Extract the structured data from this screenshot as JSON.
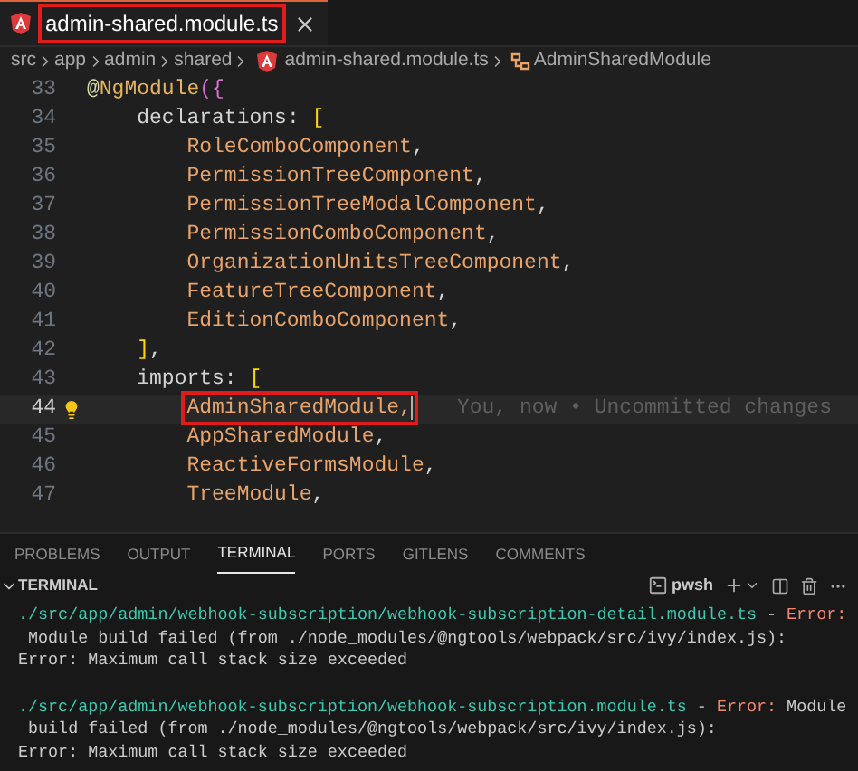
{
  "tabs": [
    {
      "label": "admin-shared.module.ts",
      "selected": true,
      "highlighted": true
    }
  ],
  "breadcrumb": {
    "folders": [
      "src",
      "app",
      "admin",
      "shared"
    ],
    "file": "admin-shared.module.ts",
    "symbol": "AdminSharedModule"
  },
  "code_lines": [
    {
      "number": "33",
      "current": false,
      "segments": [
        {
          "text": "@",
          "kind": "decorator"
        },
        {
          "text": "NgModule",
          "kind": "function"
        },
        {
          "text": "({",
          "kind": "bracket"
        }
      ]
    },
    {
      "number": "34",
      "current": false,
      "segments": [
        {
          "text": "    declarations",
          "kind": "property"
        },
        {
          "text": ": ",
          "kind": "punct"
        },
        {
          "text": "[",
          "kind": "bracket2"
        }
      ]
    },
    {
      "number": "35",
      "current": false,
      "segments": [
        {
          "text": "        RoleComboComponent",
          "kind": "class"
        },
        {
          "text": ",",
          "kind": "punct"
        }
      ]
    },
    {
      "number": "36",
      "current": false,
      "segments": [
        {
          "text": "        PermissionTreeComponent",
          "kind": "class"
        },
        {
          "text": ",",
          "kind": "punct"
        }
      ]
    },
    {
      "number": "37",
      "current": false,
      "segments": [
        {
          "text": "        PermissionTreeModalComponent",
          "kind": "class"
        },
        {
          "text": ",",
          "kind": "punct"
        }
      ]
    },
    {
      "number": "38",
      "current": false,
      "segments": [
        {
          "text": "        PermissionComboComponent",
          "kind": "class"
        },
        {
          "text": ",",
          "kind": "punct"
        }
      ]
    },
    {
      "number": "39",
      "current": false,
      "segments": [
        {
          "text": "        OrganizationUnitsTreeComponent",
          "kind": "class"
        },
        {
          "text": ",",
          "kind": "punct"
        }
      ]
    },
    {
      "number": "40",
      "current": false,
      "segments": [
        {
          "text": "        FeatureTreeComponent",
          "kind": "class"
        },
        {
          "text": ",",
          "kind": "punct"
        }
      ]
    },
    {
      "number": "41",
      "current": false,
      "segments": [
        {
          "text": "        EditionComboComponent",
          "kind": "class"
        },
        {
          "text": ",",
          "kind": "punct"
        }
      ]
    },
    {
      "number": "42",
      "current": false,
      "segments": [
        {
          "text": "    ]",
          "kind": "bracket2"
        },
        {
          "text": ",",
          "kind": "punct"
        }
      ]
    },
    {
      "number": "43",
      "current": false,
      "segments": [
        {
          "text": "    imports",
          "kind": "property"
        },
        {
          "text": ": ",
          "kind": "punct"
        },
        {
          "text": "[",
          "kind": "bracket2"
        }
      ]
    },
    {
      "number": "44",
      "current": true,
      "blame": "You, now • Uncommitted changes",
      "segments": [
        {
          "text": "        AdminSharedModule,",
          "kind": "class",
          "highlighted": true
        }
      ]
    },
    {
      "number": "45",
      "current": false,
      "segments": [
        {
          "text": "        AppSharedModule",
          "kind": "class"
        },
        {
          "text": ",",
          "kind": "punct"
        }
      ]
    },
    {
      "number": "46",
      "current": false,
      "segments": [
        {
          "text": "        ReactiveFormsModule",
          "kind": "class"
        },
        {
          "text": ",",
          "kind": "punct"
        }
      ]
    },
    {
      "number": "47",
      "current": false,
      "segments": [
        {
          "text": "        TreeModule",
          "kind": "class"
        },
        {
          "text": ",",
          "kind": "punct"
        }
      ]
    }
  ],
  "panel_tabs": [
    {
      "label": "PROBLEMS",
      "selected": false
    },
    {
      "label": "OUTPUT",
      "selected": false
    },
    {
      "label": "TERMINAL",
      "selected": true
    },
    {
      "label": "PORTS",
      "selected": false
    },
    {
      "label": "GITLENS",
      "selected": false
    },
    {
      "label": "COMMENTS",
      "selected": false
    }
  ],
  "terminal": {
    "title": "TERMINAL",
    "shell": "pwsh",
    "messages": [
      [
        [
          {
            "text": "./src/app/admin/webhook-subscription/webhook-subscription-detail.module.ts",
            "kind": "path"
          },
          {
            "text": " - ",
            "kind": "plain"
          },
          {
            "text": "Error:",
            "kind": "error"
          }
        ],
        [
          {
            "text": " Module build failed (from ./node_modules/@ngtools/webpack/src/ivy/index.js):",
            "kind": "plain"
          }
        ],
        [
          {
            "text": "Error: Maximum call stack size exceeded",
            "kind": "plain"
          }
        ]
      ],
      [
        [
          {
            "text": "./src/app/admin/webhook-subscription/webhook-subscription.module.ts",
            "kind": "path"
          },
          {
            "text": " - ",
            "kind": "plain"
          },
          {
            "text": "Error:",
            "kind": "error"
          },
          {
            "text": " Module",
            "kind": "plain"
          }
        ],
        [
          {
            "text": " build failed (from ./node_modules/@ngtools/webpack/src/ivy/index.js):",
            "kind": "plain"
          }
        ],
        [
          {
            "text": "Error: Maximum call stack size exceeded",
            "kind": "plain"
          }
        ]
      ]
    ]
  }
}
